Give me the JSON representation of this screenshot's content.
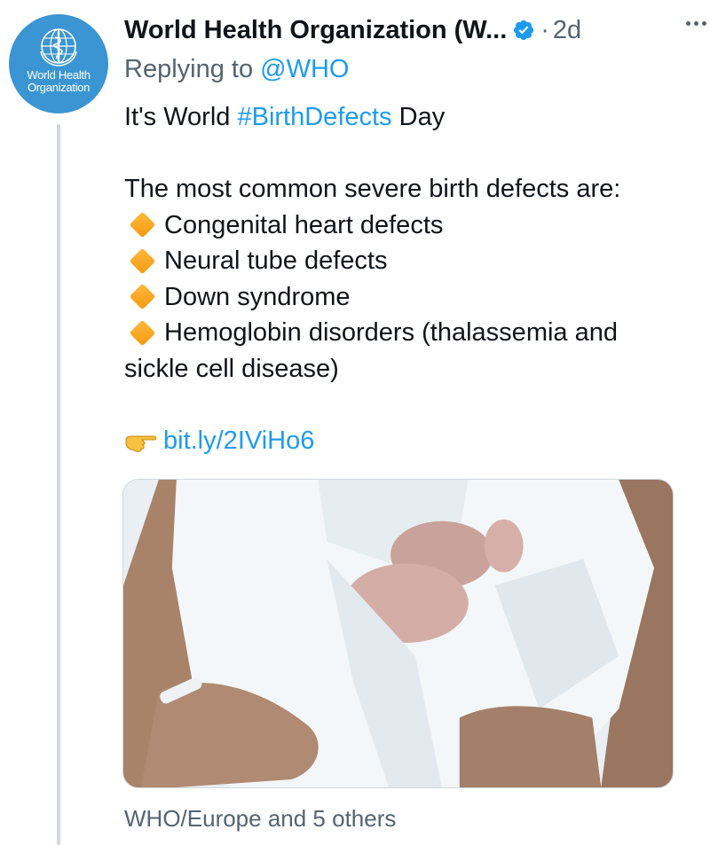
{
  "tweet": {
    "avatar": {
      "icon": "who-emblem-icon",
      "line1": "World Health",
      "line2": "Organization",
      "color": "#3b95d3"
    },
    "display_name": "World Health Organization (W...",
    "verified_icon": "verified-badge-icon",
    "separator": "·",
    "timestamp": "2d",
    "more_icon": "more-options-icon",
    "replying_prefix": "Replying to ",
    "replying_handle": "@WHO",
    "body": {
      "line1_prefix": "It's World ",
      "hashtag": "#BirthDefects",
      "line1_suffix": " Day",
      "intro": "The most common severe birth defects are:",
      "bullets": [
        "Congenital heart defects",
        "Neural tube defects",
        "Down syndrome",
        "Hemoglobin disorders (thalassemia and"
      ],
      "bullet_continuation": "sickle cell disease)",
      "bullet_icon": "orange-diamond-icon",
      "link_icon": "pointing-hand-icon",
      "link": "bit.ly/2IViHo6"
    },
    "media": {
      "description_icon": "newborn-photo-image"
    },
    "tagged": "WHO/Europe and 5 others"
  },
  "colors": {
    "link": "#1d9bf0",
    "secondary_text": "#536471",
    "primary_text": "#0f1419",
    "thread_line": "#cfd9de"
  }
}
